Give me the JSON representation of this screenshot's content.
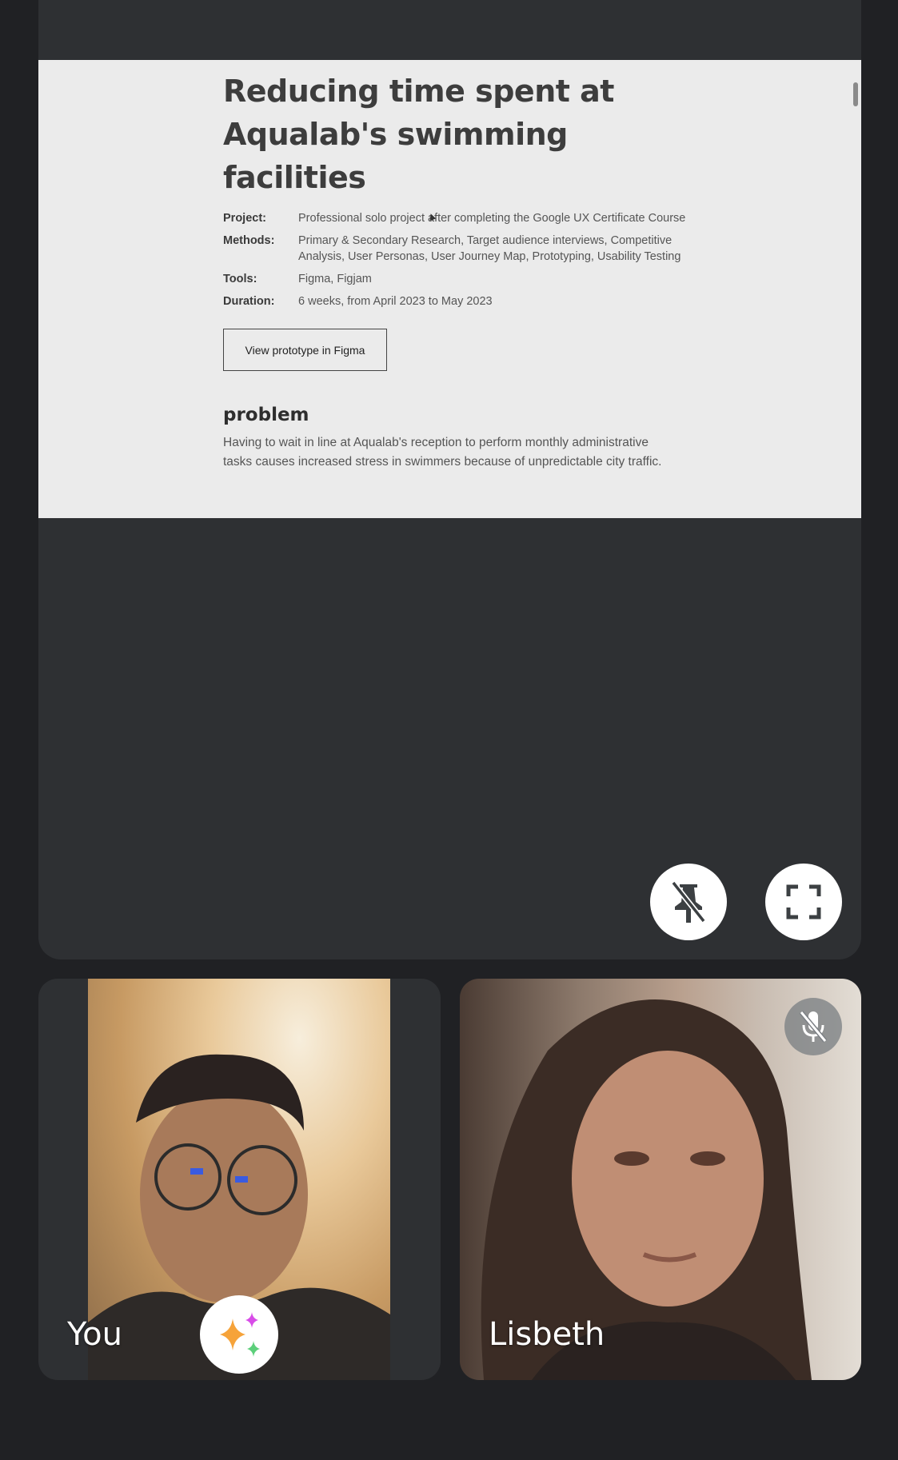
{
  "shared_doc": {
    "title": "Reducing time spent at Aqualab's swimming facilities",
    "meta": [
      {
        "key": "Project:",
        "value": "Professional solo project after completing the Google UX Certificate Course"
      },
      {
        "key": "Methods:",
        "value": "Primary & Secondary Research, Target audience interviews, Competitive Analysis, User Personas, User Journey Map, Prototyping, Usability Testing"
      },
      {
        "key": "Tools:",
        "value": "Figma, Figjam"
      },
      {
        "key": "Duration:",
        "value": "6 weeks, from April 2023 to May 2023"
      }
    ],
    "prototype_button": "View prototype in Figma",
    "section_heading": "problem",
    "section_body": "Having to wait in line at Aqualab's reception to perform monthly administrative tasks causes increased stress in swimmers because of unpredictable city traffic."
  },
  "controls": {
    "unpin_icon": "unpin-icon",
    "fullscreen_icon": "fullscreen-icon"
  },
  "participants": {
    "self_name": "You",
    "other_name": "Lisbeth",
    "effects_icon": "sparkle-effects-icon",
    "muted_icon": "mic-off-icon"
  }
}
